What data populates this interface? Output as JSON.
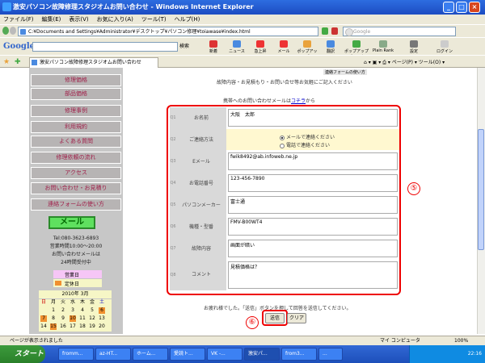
{
  "window": {
    "title": "激安パソコン故障修理スタジオムお問い合わせ - Windows Internet Explorer",
    "buttons": [
      "_",
      "□",
      "×"
    ]
  },
  "menu": [
    "ファイル(F)",
    "編集(E)",
    "表示(V)",
    "お気に入り(A)",
    "ツール(T)",
    "ヘルプ(H)"
  ],
  "address": {
    "value": "C:¥Documents and Settings¥Administrator¥デスクトップ¥パソコン修理¥toiawase¥index.html",
    "search_placeholder": "Google"
  },
  "googlebar": {
    "logo": "Google",
    "search_label": "検索",
    "tools": [
      {
        "label": "新着",
        "color": "#d33"
      },
      {
        "label": "ニュース",
        "color": "#4a8ae0"
      },
      {
        "label": "急上昇",
        "color": "#e33"
      },
      {
        "label": "メール",
        "color": "#e33"
      },
      {
        "label": "ポップアップ",
        "color": "#e9a23b"
      },
      {
        "label": "翻訳",
        "color": "#4a8ae0"
      },
      {
        "label": "ポップアップ ブロック",
        "color": "#4a4"
      },
      {
        "label": "Plain Rank",
        "color": "#8a8"
      },
      {
        "label": "設定",
        "color": "#777"
      },
      {
        "label": "ログイン",
        "color": "#ccc"
      }
    ]
  },
  "tab": {
    "label": "激安パソコン故障修理スタジオムお問い合わせ"
  },
  "sidebar": {
    "nav": [
      "修理価格",
      "部品価格",
      "修理事例",
      "利用規約",
      "よくある質問",
      "修理依頼の流れ",
      "アクセス",
      "お問い合わせ・お見積り",
      "連絡フォームの使い方"
    ],
    "mail_button": "メール",
    "tel": "Tel:080-3623-6893",
    "hours": "営業時間10:00〜20:00",
    "inquiry": "お問い合わせメールは",
    "accept": "24時間受付中",
    "legend_open": "営業日",
    "legend_closed": "定休日",
    "calendar_title": "2010年 3月",
    "calendar_days": [
      "日",
      "月",
      "火",
      "水",
      "木",
      "金",
      "土"
    ],
    "calendar_rows": [
      [
        "",
        "1",
        "2",
        "3",
        "4",
        "5",
        "6"
      ],
      [
        "7",
        "8",
        "9",
        "10",
        "11",
        "12",
        "13"
      ],
      [
        "14",
        "15",
        "16",
        "17",
        "18",
        "19",
        "20"
      ]
    ]
  },
  "main": {
    "link_tag": "連絡フォームの使い方",
    "intro": "故障内容・お見積もり・お問い合せ等お気軽にご記入ください",
    "mobile_note": "携帯へのお問い合わせメールは",
    "mobile_link": "コチラ",
    "mobile_suffix": "から",
    "rows": [
      {
        "num": "Q1",
        "label": "お名前",
        "value": "大阪　太郎"
      },
      {
        "num": "Q2",
        "label": "ご連絡方法",
        "value": ""
      },
      {
        "num": "Q3",
        "label": "Eメール",
        "value": "fwik8492@ab.infoweb.ne.jp"
      },
      {
        "num": "Q4",
        "label": "お電話番号",
        "value": "123-456-7890"
      },
      {
        "num": "Q5",
        "label": "パソコンメーカー",
        "value": "富士通"
      },
      {
        "num": "Q6",
        "label": "機種・型番",
        "value": "FMV-B00WT4"
      },
      {
        "num": "Q7",
        "label": "故障内容",
        "value": "画面が暗い"
      },
      {
        "num": "Q8",
        "label": "コメント",
        "value": "見積価格は？"
      }
    ],
    "contact_options": [
      "メールで連絡ください",
      "電話で連絡ください"
    ],
    "footer_note": "お疲れ様でした。「送信」ボタンを押して回答を送信してください。",
    "submit": "送信",
    "clear": "クリア",
    "callout_5": "⑤",
    "callout_6": "⑥"
  },
  "statusbar": {
    "left": "ページが表示されました",
    "zone": "マイ コンピュータ",
    "zoom": "100%"
  },
  "taskbar": {
    "start": "スタート",
    "tasks": [
      "fromm...",
      "az-HT...",
      "ホーム...",
      "愛読ト...",
      "VK -...",
      "激安パ...",
      "from3...",
      "..."
    ],
    "clock": "22:16"
  }
}
